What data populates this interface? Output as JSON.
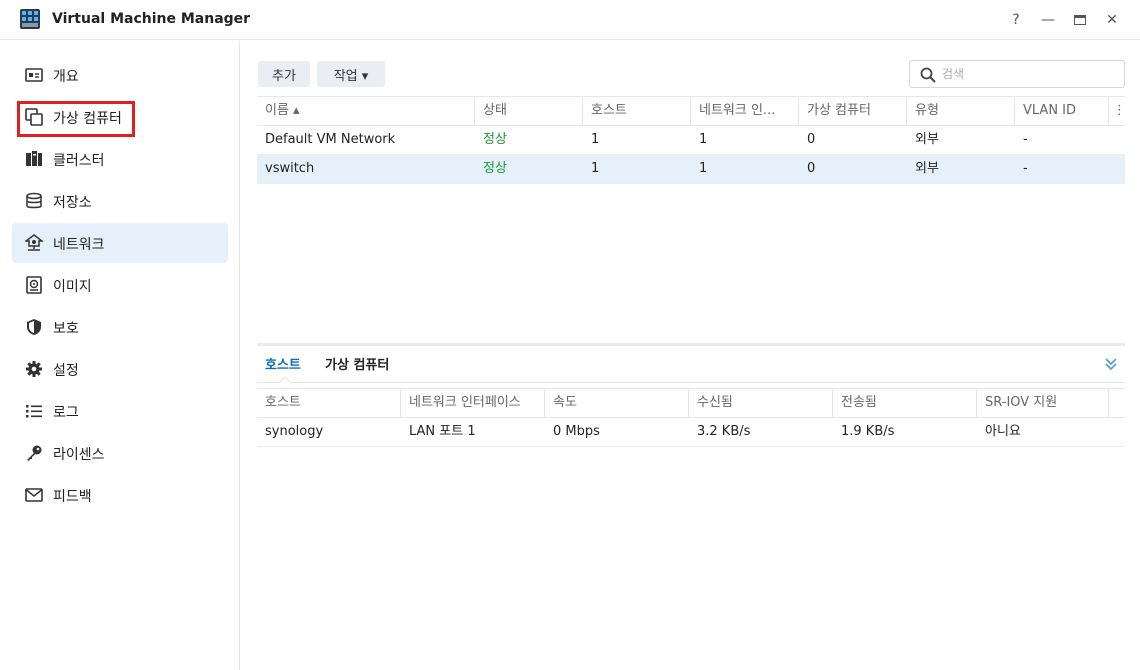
{
  "window": {
    "title": "Virtual Machine Manager",
    "controls": [
      "?",
      "—",
      "□",
      "✕"
    ]
  },
  "sidebar": {
    "items": [
      {
        "label": "개요",
        "icon": "overview-icon"
      },
      {
        "label": "가상 컴퓨터",
        "icon": "virtual-machine-icon"
      },
      {
        "label": "클러스터",
        "icon": "cluster-icon"
      },
      {
        "label": "저장소",
        "icon": "storage-icon"
      },
      {
        "label": "네트워크",
        "icon": "network-icon"
      },
      {
        "label": "이미지",
        "icon": "image-icon"
      },
      {
        "label": "보호",
        "icon": "protection-icon"
      },
      {
        "label": "설정",
        "icon": "settings-icon"
      },
      {
        "label": "로그",
        "icon": "log-icon"
      },
      {
        "label": "라이센스",
        "icon": "license-icon"
      },
      {
        "label": "피드백",
        "icon": "feedback-icon"
      }
    ],
    "active": "네트워크",
    "highlighted": "가상 컴퓨터"
  },
  "toolbar": {
    "add_label": "추가",
    "action_label": "작업 ▾",
    "search_placeholder": "검색"
  },
  "network_table": {
    "columns": [
      "이름 ▴",
      "상태",
      "호스트",
      "네트워크 인...",
      "가상 컴퓨터",
      "유형",
      "VLAN ID"
    ],
    "rows": [
      [
        "Default VM Network",
        "정상",
        "1",
        "1",
        "0",
        "외부",
        "-"
      ],
      [
        "vswitch",
        "정상",
        "1",
        "1",
        "0",
        "외부",
        "-"
      ]
    ],
    "selected_row": 1
  },
  "detail": {
    "tabs": [
      "호스트",
      "가상 컴퓨터"
    ],
    "active_tab": "호스트",
    "columns": [
      "호스트",
      "네트워크 인터페이스",
      "속도",
      "수신됨",
      "전송됨",
      "SR-IOV 지원"
    ],
    "rows": [
      [
        "synology",
        "LAN 포트 1",
        "0 Mbps",
        "3.2 KB/s",
        "1.9 KB/s",
        "아니요"
      ]
    ]
  },
  "colors": {
    "accent": "#0a6ebd",
    "selection": "#e5f0fb",
    "status_ok": "#1a9a30",
    "highlight": "#e02020"
  }
}
